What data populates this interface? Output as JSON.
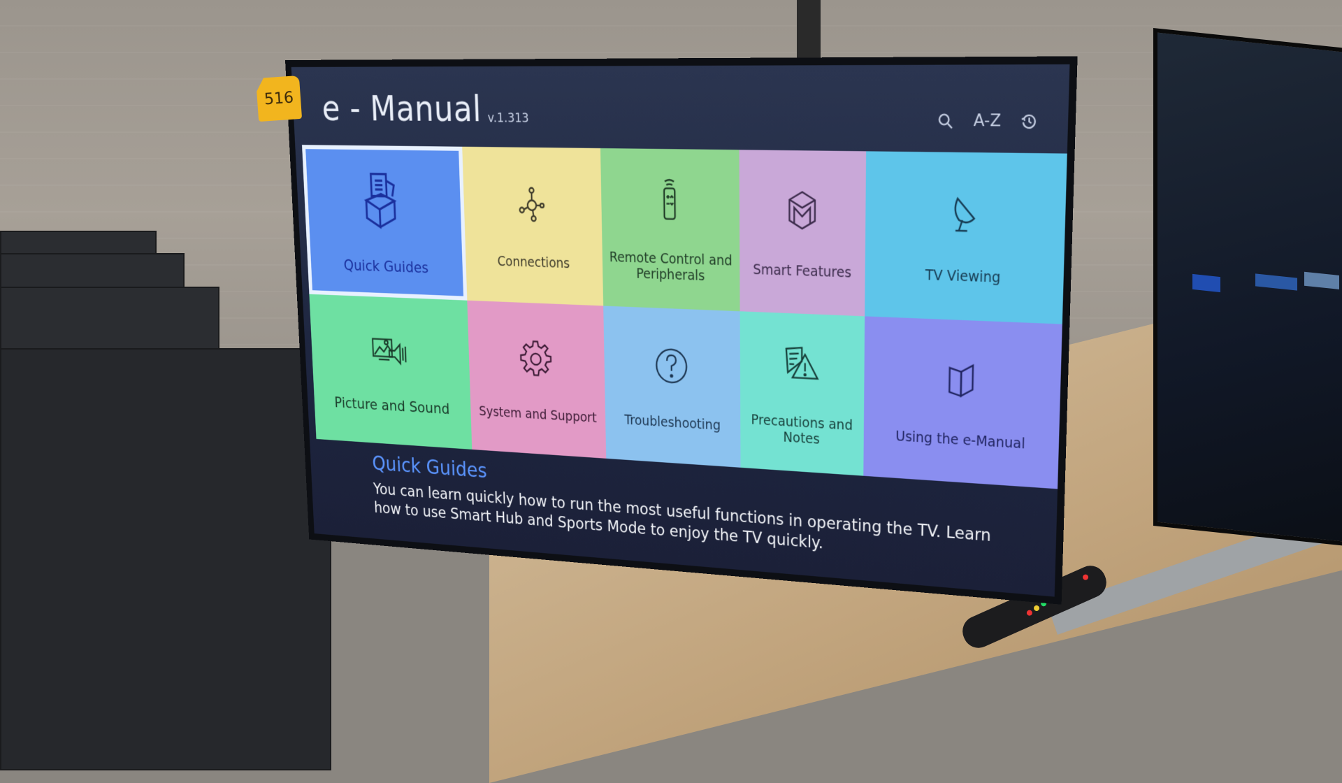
{
  "scene": {
    "price_tag": "516"
  },
  "app": {
    "title": "e - Manual",
    "version": "v.1.313",
    "tools": [
      {
        "name": "search",
        "icon": "search-icon",
        "label": ""
      },
      {
        "name": "a-z",
        "icon": "az-index-icon",
        "label": "A-Z"
      },
      {
        "name": "history",
        "icon": "history-icon",
        "label": ""
      }
    ]
  },
  "tiles": [
    {
      "label": "Quick Guides",
      "icon": "box-document-icon",
      "color": "#5b8ff0",
      "text_color": "#1a2f9c",
      "selected": true
    },
    {
      "label": "Connections",
      "icon": "network-hub-icon",
      "color": "#efe39a",
      "text_color": "#3d3a2a"
    },
    {
      "label": "Remote Control and Peripherals",
      "icon": "remote-control-icon",
      "color": "#8fd68f",
      "text_color": "#1f3b26"
    },
    {
      "label": "Smart Features",
      "icon": "smart-cube-icon",
      "color": "#c9a8d8",
      "text_color": "#3a2a4a"
    },
    {
      "label": "TV Viewing",
      "icon": "satellite-dish-icon",
      "color": "#5ec5ea",
      "text_color": "#173b52"
    },
    {
      "label": "Picture and Sound",
      "icon": "picture-sound-icon",
      "color": "#6ee0a2",
      "text_color": "#1a3b2a"
    },
    {
      "label": "System and Support",
      "icon": "gear-icon",
      "color": "#e29ac6",
      "text_color": "#3b1a34"
    },
    {
      "label": "Troubleshooting",
      "icon": "question-circle-icon",
      "color": "#8cc2ef",
      "text_color": "#1c3550"
    },
    {
      "label": "Precautions and Notes",
      "icon": "document-warning-icon",
      "color": "#74e2d2",
      "text_color": "#173f3a"
    },
    {
      "label": "Using the e-Manual",
      "icon": "open-book-icon",
      "color": "#8a8ef0",
      "text_color": "#202460"
    }
  ],
  "description": {
    "title": "Quick Guides",
    "body": "You can learn quickly how to run the most useful functions in operating the TV. Learn how to use Smart Hub and Sports Mode to enjoy the TV quickly.",
    "title_color": "#5b95ff"
  }
}
